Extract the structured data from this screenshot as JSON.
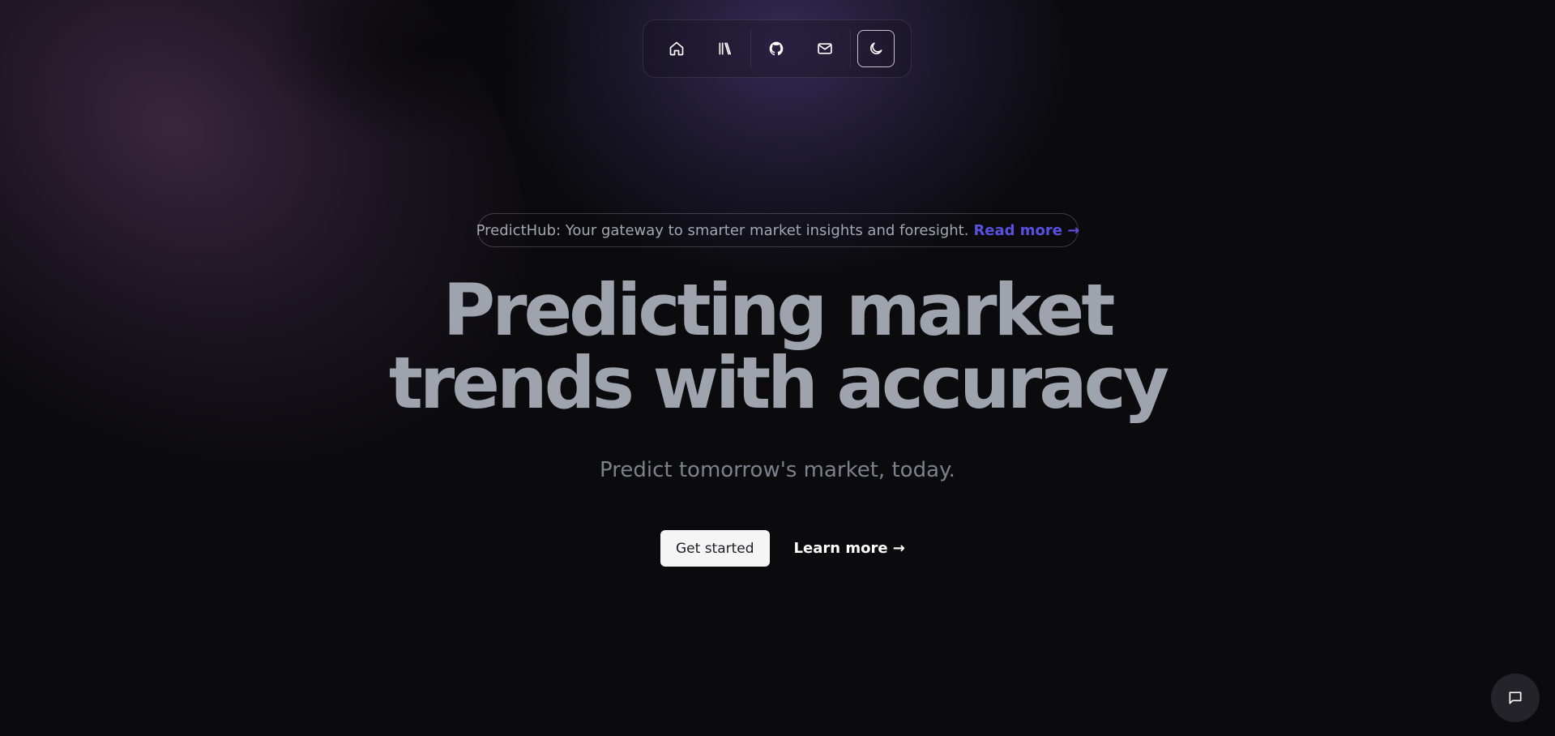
{
  "nav": {
    "items": [
      {
        "icon": "home-icon"
      },
      {
        "icon": "library-icon"
      },
      {
        "icon": "github-icon"
      },
      {
        "icon": "mail-icon"
      },
      {
        "icon": "moon-icon",
        "active": true
      }
    ]
  },
  "banner": {
    "text": "PredictHub: Your gateway to smarter market insights and foresight.",
    "link_label": "Read more →",
    "link_color": "#5b4fe0"
  },
  "hero": {
    "title_line1": "Predicting market",
    "title_line2": "trends with accuracy",
    "subtitle": "Predict tomorrow's market, today."
  },
  "cta": {
    "primary_label": "Get started",
    "secondary_label": "Learn more →"
  },
  "chat": {
    "icon": "chat-icon"
  },
  "colors": {
    "background": "#0b0b0e",
    "headline": "#9ea3ae",
    "accent": "#5b4fe0"
  }
}
